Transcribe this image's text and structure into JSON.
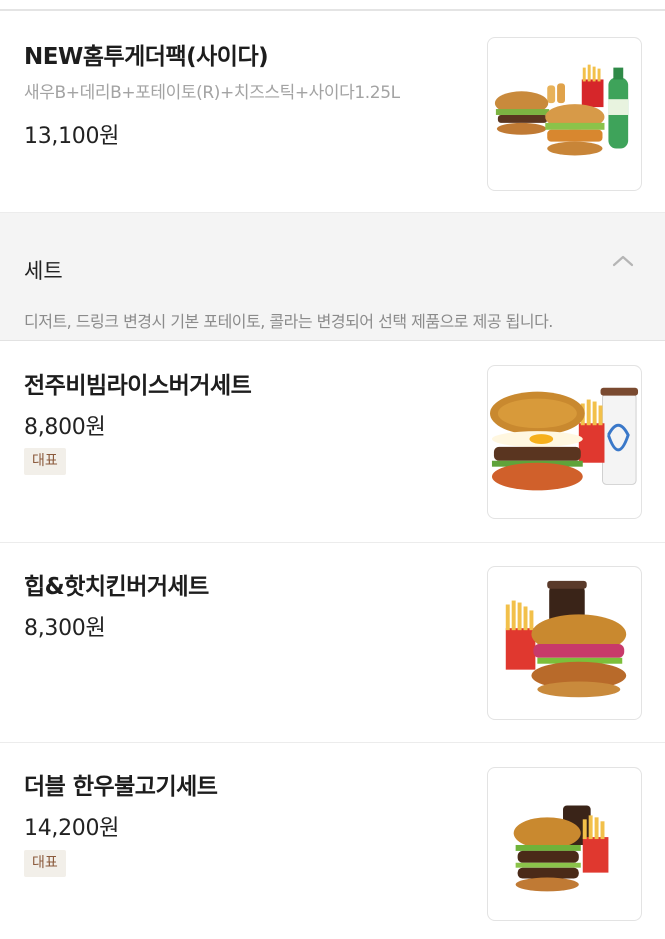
{
  "items_top": {
    "title": "NEW홈투게더팩(사이다)",
    "description": "새우B+데리B+포테이토(R)+치즈스틱+사이다1.25L",
    "price": "13,100원",
    "image": "home-together-pack-image"
  },
  "section": {
    "title": "세트",
    "notice": "디저트, 드링크 변경시 기본 포테이토, 콜라는 변경되어 선택 제품으로 제공 됩니다.",
    "toggle_icon": "chevron-up-icon"
  },
  "set_items": [
    {
      "title": "전주비빔라이스버거세트",
      "price": "8,800원",
      "badge": "대표",
      "image": "jeonju-bibim-rice-burger-set-image"
    },
    {
      "title": "힙&핫치킨버거세트",
      "price": "8,300원",
      "badge": "",
      "image": "hip-hot-chicken-burger-set-image"
    },
    {
      "title": "더블 한우불고기세트",
      "price": "14,200원",
      "badge": "대표",
      "image": "double-hanwoo-bulgogi-set-image"
    }
  ],
  "colors": {
    "badge_bg": "#f2efe9",
    "badge_text": "#8b5a3c",
    "section_bg": "#f4f4f4"
  }
}
